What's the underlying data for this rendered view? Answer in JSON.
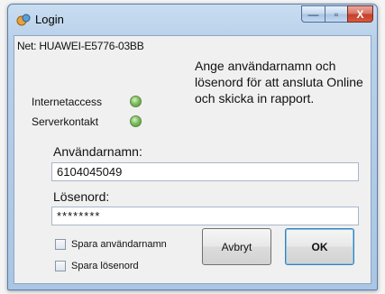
{
  "window": {
    "title": "Login"
  },
  "titlebar_buttons": {
    "minimize": "—",
    "maximize": "▫",
    "close": "X"
  },
  "network": {
    "label": "Net: HUAWEI-E5776-03BB"
  },
  "info": {
    "text": "Ange användarnamn och lösenord för att ansluta Online och skicka in rapport."
  },
  "status": {
    "internet_label": "Internetaccess",
    "server_label": "Serverkontakt",
    "led_color": "#6fb54c"
  },
  "form": {
    "username_label": "Användarnamn:",
    "username_value": "6104045049",
    "password_label": "Lösenord:",
    "password_value": "********"
  },
  "options": {
    "save_username_label": "Spara användarnamn",
    "save_password_label": "Spara lösenord"
  },
  "buttons": {
    "cancel_label": "Avbryt",
    "ok_label": "OK"
  }
}
